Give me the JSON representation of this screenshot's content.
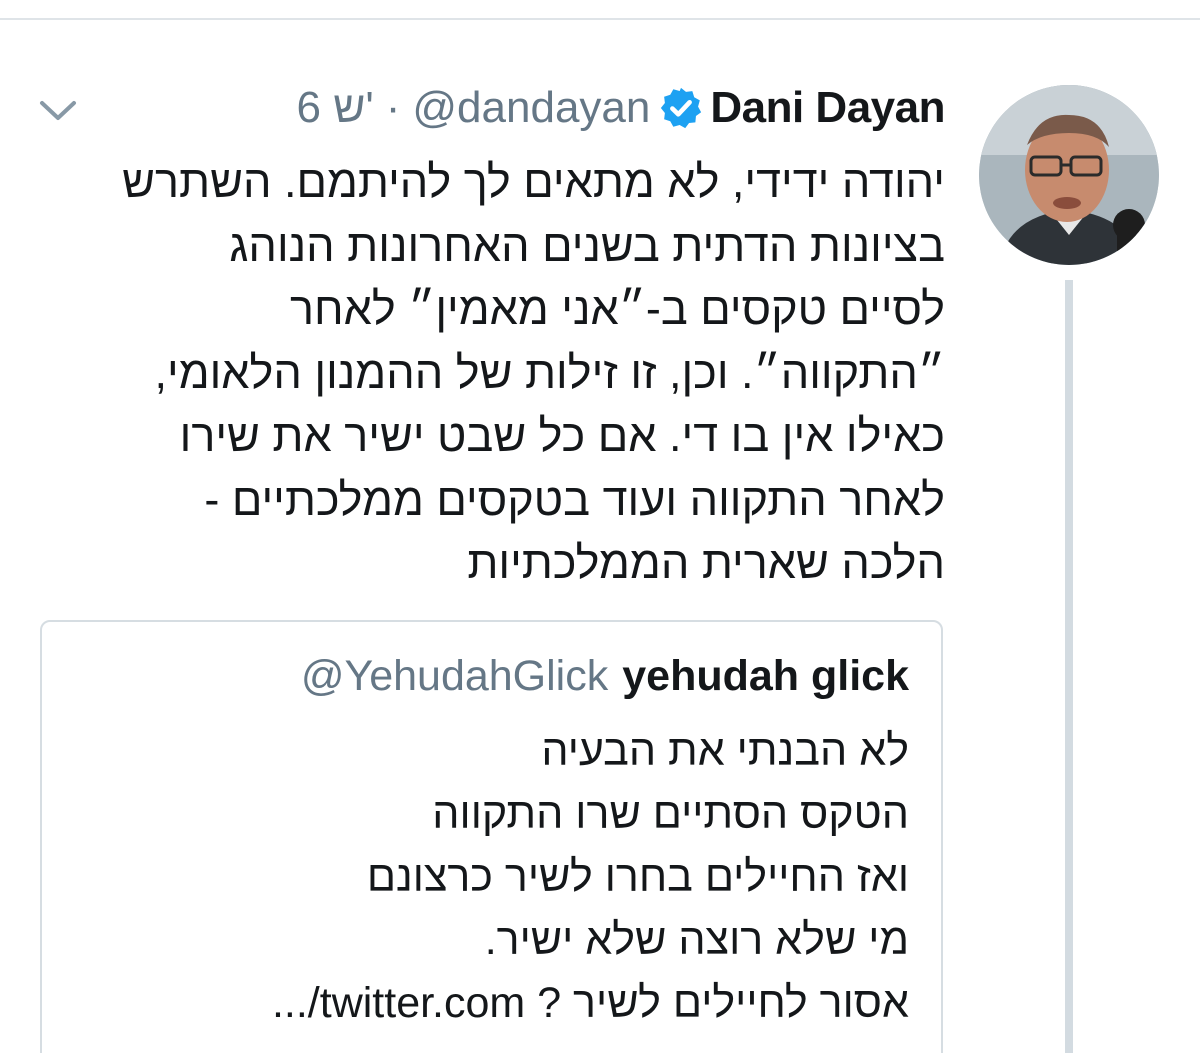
{
  "tweet": {
    "author_name": "Dani Dayan",
    "author_handle": "@dandayan",
    "separator": "·",
    "time": "6 ש'",
    "lines": [
      "יהודה ידידי, לא מתאים לך להיתמם. השתרש",
      "בציונות הדתית בשנים האחרונות הנוהג",
      "לסיים טקסים ב-״אני מאמין״ לאחר",
      "״התקווה״. וכן, זו זילות של ההמנון הלאומי,",
      "כאילו אין בו די. אם כל שבט ישיר את שירו",
      "לאחר התקווה ועוד בטקסים ממלכתיים -",
      "הלכה שארית הממלכתיות"
    ]
  },
  "quoted_tweet": {
    "author_name": "yehudah glick",
    "author_handle": "@YehudahGlick",
    "lines": [
      "לא הבנתי את הבעיה",
      "הטקס הסתיים שרו התקווה",
      "ואז החיילים בחרו לשיר כרצונם",
      "מי שלא רוצה שלא ישיר.",
      "אסור לחיילים לשיר ? twitter.com/..."
    ]
  },
  "icons": {
    "verified": "verified-badge-icon",
    "menu": "chevron-down-icon",
    "avatar": "avatar"
  },
  "colors": {
    "primary_text": "#14171a",
    "secondary_text": "#657786",
    "verified_blue": "#1da1f2",
    "border": "#d6dde2",
    "thread_line": "#d3dbe1"
  }
}
